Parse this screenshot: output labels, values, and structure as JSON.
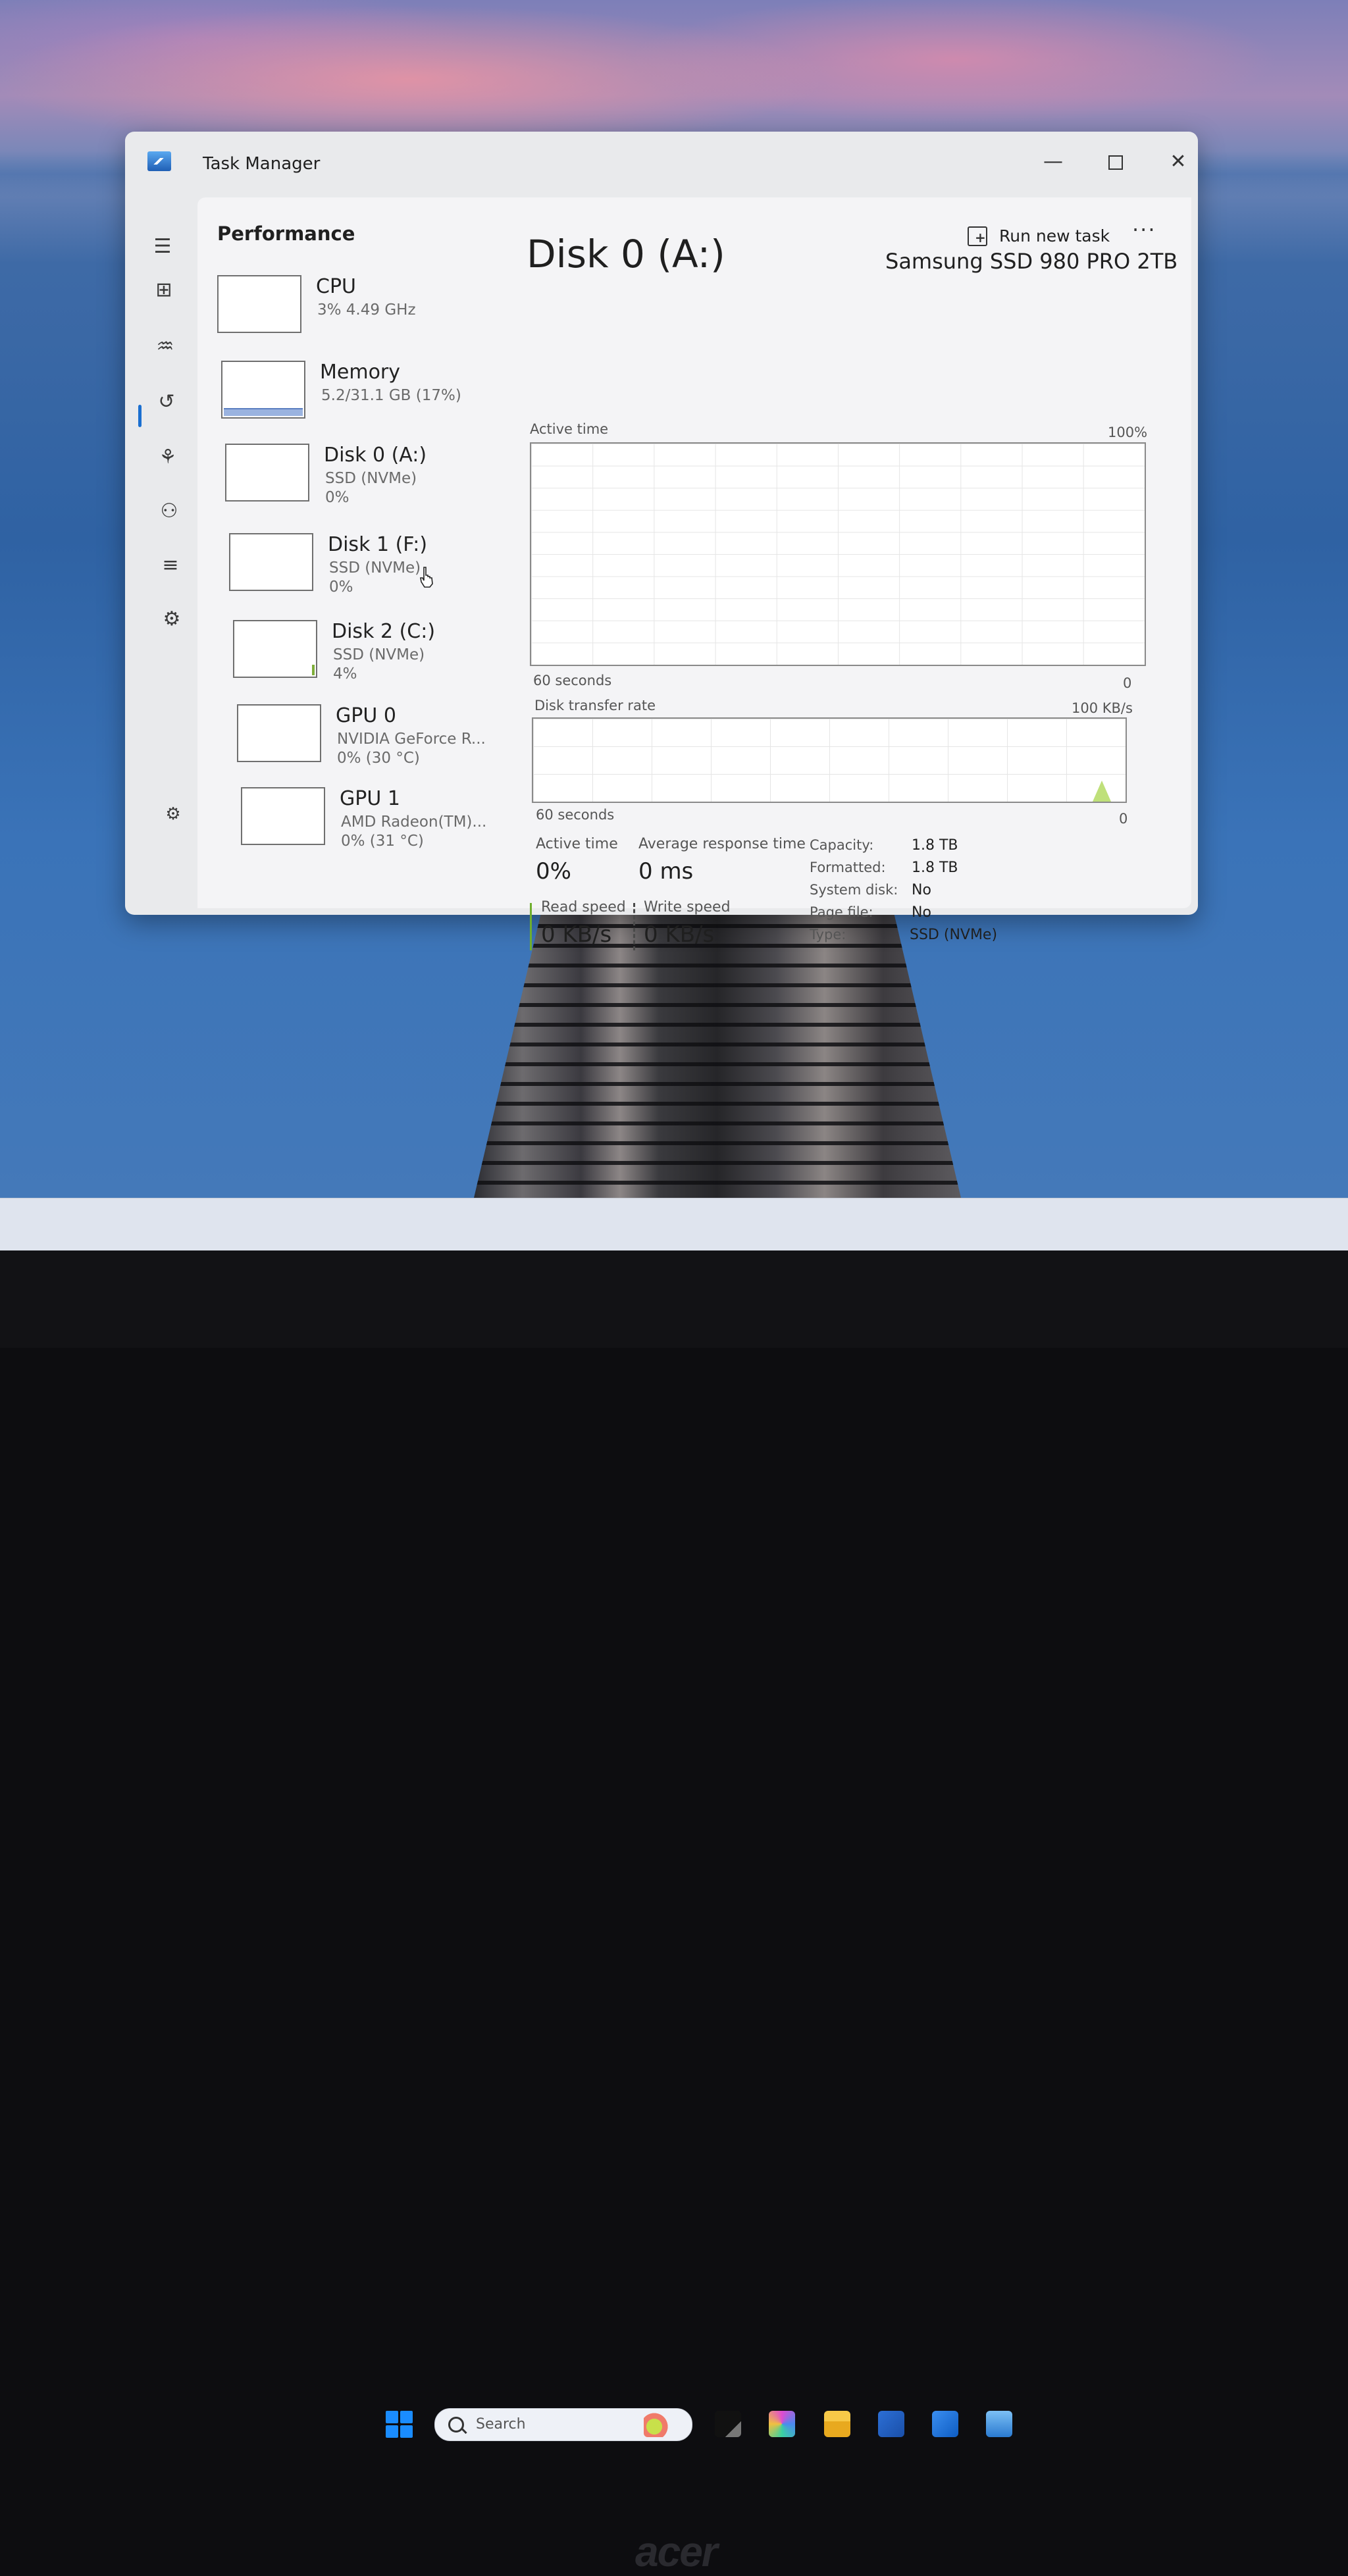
{
  "window": {
    "title": "Task Manager",
    "minimize_glyph": "—",
    "close_glyph": "✕"
  },
  "header": {
    "title": "Performance",
    "run_new_task": "Run new task",
    "more_glyph": "···"
  },
  "nav": [
    {
      "icon": "hamburger-icon",
      "glyph": "☰"
    },
    {
      "icon": "processes-icon",
      "glyph": "⊞"
    },
    {
      "icon": "performance-icon",
      "glyph": "♒",
      "selected": true
    },
    {
      "icon": "app-history-icon",
      "glyph": "↺"
    },
    {
      "icon": "startup-apps-icon",
      "glyph": "⚘"
    },
    {
      "icon": "users-icon",
      "glyph": "⚇"
    },
    {
      "icon": "details-icon",
      "glyph": "≡"
    },
    {
      "icon": "services-icon",
      "glyph": "⚙"
    },
    {
      "icon": "settings-icon",
      "glyph": "⚙"
    }
  ],
  "devices": [
    {
      "name": "CPU",
      "sub": "3%  4.49 GHz",
      "sub2": ""
    },
    {
      "name": "Memory",
      "sub": "5.2/31.1 GB (17%)",
      "sub2": ""
    },
    {
      "name": "Disk 0 (A:)",
      "sub": "SSD (NVMe)",
      "sub2": "0%"
    },
    {
      "name": "Disk 1 (F:)",
      "sub": "SSD (NVMe)",
      "sub2": "0%"
    },
    {
      "name": "Disk 2 (C:)",
      "sub": "SSD (NVMe)",
      "sub2": "4%"
    },
    {
      "name": "GPU 0",
      "sub": "NVIDIA GeForce R...",
      "sub2": "0%  (30 °C)"
    },
    {
      "name": "GPU 1",
      "sub": "AMD Radeon(TM)...",
      "sub2": "0%  (31 °C)"
    }
  ],
  "detail": {
    "title": "Disk 0 (A:)",
    "model": "Samsung SSD 980 PRO 2TB",
    "active_graph": {
      "label": "Active time",
      "max": "100%",
      "span": "60 seconds",
      "min": "0"
    },
    "transfer_graph": {
      "label": "Disk transfer rate",
      "max": "100 KB/s",
      "span": "60 seconds",
      "min": "0"
    },
    "stats": {
      "active_time_label": "Active time",
      "active_time_value": "0%",
      "avg_response_label": "Average response time",
      "avg_response_value": "0 ms",
      "read_label": "Read speed",
      "read_value": "0 KB/s",
      "write_label": "Write speed",
      "write_value": "0 KB/s"
    },
    "properties": [
      {
        "key": "Capacity:",
        "value": "1.8 TB"
      },
      {
        "key": "Formatted:",
        "value": "1.8 TB"
      },
      {
        "key": "System disk:",
        "value": "No"
      },
      {
        "key": "Page file:",
        "value": "No"
      },
      {
        "key": "Type:",
        "value": "SSD (NVMe)"
      }
    ]
  },
  "taskbar": {
    "search_placeholder": "Search"
  },
  "bezel_brand": "acer"
}
